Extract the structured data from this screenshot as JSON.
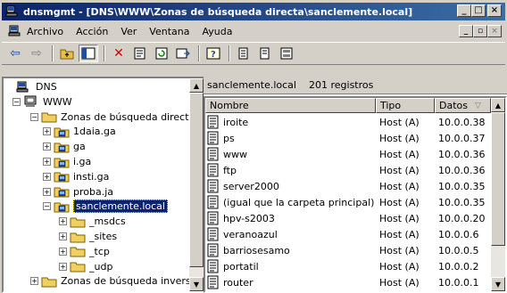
{
  "window": {
    "title": "dnsmgmt - [DNS\\WWW\\Zonas de búsqueda directa\\sanclemente.local]",
    "minimize": "_",
    "maximize": "□",
    "close": "×"
  },
  "menu": {
    "items": [
      "Archivo",
      "Acción",
      "Ver",
      "Ventana",
      "Ayuda"
    ],
    "mdi": {
      "minimize": "_",
      "restore": "▫",
      "close": "×"
    }
  },
  "toolbar": {
    "buttons": [
      {
        "name": "back-icon",
        "glyph": "⇦"
      },
      {
        "name": "forward-icon",
        "glyph": "⇨"
      },
      {
        "name": "up-folder-icon",
        "glyph": "📁"
      },
      {
        "name": "show-tree-icon",
        "glyph": "▦"
      },
      {
        "name": "delete-icon",
        "glyph": "✕"
      },
      {
        "name": "properties-icon",
        "glyph": "🗎"
      },
      {
        "name": "refresh-icon",
        "glyph": "↻"
      },
      {
        "name": "export-icon",
        "glyph": "⇲"
      },
      {
        "name": "help-icon",
        "glyph": "?"
      },
      {
        "name": "record-icon",
        "glyph": "▤"
      },
      {
        "name": "record2-icon",
        "glyph": "▤"
      },
      {
        "name": "server-icon",
        "glyph": "▦"
      }
    ]
  },
  "tree": {
    "nodes": [
      {
        "label": "DNS",
        "level": 0,
        "icon": "dns",
        "expander": ""
      },
      {
        "label": "WWW",
        "level": 1,
        "icon": "server",
        "expander": "-"
      },
      {
        "label": "Zonas de búsqueda direct",
        "level": 2,
        "icon": "folder",
        "expander": "-"
      },
      {
        "label": "1daia.ga",
        "level": 3,
        "icon": "zone",
        "expander": "+"
      },
      {
        "label": "ga",
        "level": 3,
        "icon": "zone",
        "expander": "+"
      },
      {
        "label": "i.ga",
        "level": 3,
        "icon": "zone",
        "expander": "+"
      },
      {
        "label": "insti.ga",
        "level": 3,
        "icon": "zone",
        "expander": "+"
      },
      {
        "label": "proba.ja",
        "level": 3,
        "icon": "zone",
        "expander": "+"
      },
      {
        "label": "sanclemente.local",
        "level": 3,
        "icon": "zone",
        "expander": "-",
        "selected": true
      },
      {
        "label": "_msdcs",
        "level": 4,
        "icon": "folder",
        "expander": "+"
      },
      {
        "label": "_sites",
        "level": 4,
        "icon": "folder",
        "expander": "+"
      },
      {
        "label": "_tcp",
        "level": 4,
        "icon": "folder",
        "expander": "+"
      },
      {
        "label": "_udp",
        "level": 4,
        "icon": "folder",
        "expander": "+"
      },
      {
        "label": "Zonas de búsqueda invers",
        "level": 2,
        "icon": "folder",
        "expander": "+"
      }
    ]
  },
  "details": {
    "zone": "sanclemente.local",
    "count": "201 registros",
    "columns": [
      {
        "label": "Nombre"
      },
      {
        "label": "Tipo"
      },
      {
        "label": "Datos",
        "sort": "▽"
      }
    ],
    "rows": [
      {
        "name": "iroite",
        "type": "Host (A)",
        "data": "10.0.0.38"
      },
      {
        "name": "ps",
        "type": "Host (A)",
        "data": "10.0.0.37"
      },
      {
        "name": "www",
        "type": "Host (A)",
        "data": "10.0.0.36"
      },
      {
        "name": "ftp",
        "type": "Host (A)",
        "data": "10.0.0.36"
      },
      {
        "name": "server2000",
        "type": "Host (A)",
        "data": "10.0.0.35"
      },
      {
        "name": "(igual que la carpeta principal)",
        "type": "Host (A)",
        "data": "10.0.0.35"
      },
      {
        "name": "hpv-s2003",
        "type": "Host (A)",
        "data": "10.0.0.20"
      },
      {
        "name": "veranoazul",
        "type": "Host (A)",
        "data": "10.0.0.6"
      },
      {
        "name": "barriosesamo",
        "type": "Host (A)",
        "data": "10.0.0.5"
      },
      {
        "name": "portatil",
        "type": "Host (A)",
        "data": "10.0.0.2"
      },
      {
        "name": "router",
        "type": "Host (A)",
        "data": "10.0.0.1"
      }
    ]
  }
}
